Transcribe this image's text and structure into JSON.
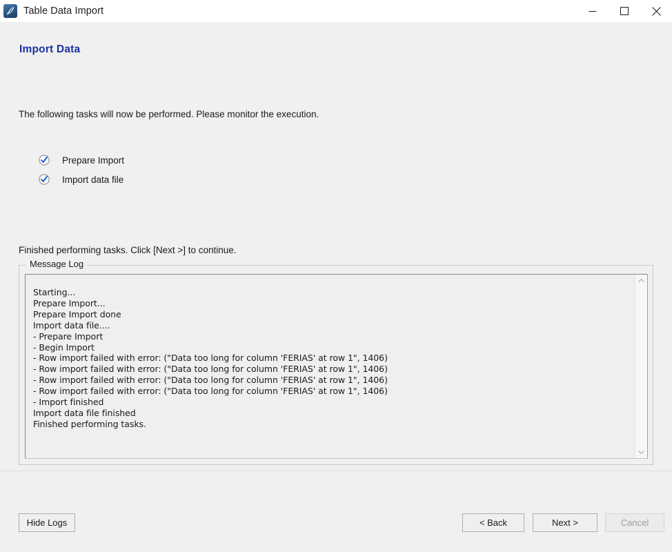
{
  "window": {
    "title": "Table Data Import",
    "icon": "workbench-dolphin-icon",
    "controls": {
      "minimize": "minimize-icon",
      "maximize": "maximize-icon",
      "close": "close-icon"
    }
  },
  "page": {
    "title": "Import Data",
    "title_color": "#1c30a0",
    "intro": "The following tasks will now be performed. Please monitor the execution.",
    "status": "Finished performing tasks. Click [Next >] to continue."
  },
  "tasks": [
    {
      "label": "Prepare Import",
      "state": "done",
      "icon": "check-circle-icon"
    },
    {
      "label": "Import data file",
      "state": "done",
      "icon": "check-circle-icon"
    }
  ],
  "log": {
    "legend": "Message Log",
    "lines": [
      "Starting...",
      "Prepare Import...",
      "Prepare Import done",
      "Import data file....",
      "- Prepare Import",
      "- Begin Import",
      "- Row import failed with error: (\"Data too long for column 'FERIAS' at row 1\", 1406)",
      "- Row import failed with error: (\"Data too long for column 'FERIAS' at row 1\", 1406)",
      "- Row import failed with error: (\"Data too long for column 'FERIAS' at row 1\", 1406)",
      "- Row import failed with error: (\"Data too long for column 'FERIAS' at row 1\", 1406)",
      "- Import finished",
      "Import data file finished",
      "Finished performing tasks."
    ],
    "scrollbar": {
      "up_arrow": "chevron-up-icon",
      "down_arrow": "chevron-down-icon"
    }
  },
  "footer": {
    "hide_logs": "Hide Logs",
    "back": "< Back",
    "next": "Next >",
    "cancel": "Cancel",
    "cancel_disabled": true
  }
}
